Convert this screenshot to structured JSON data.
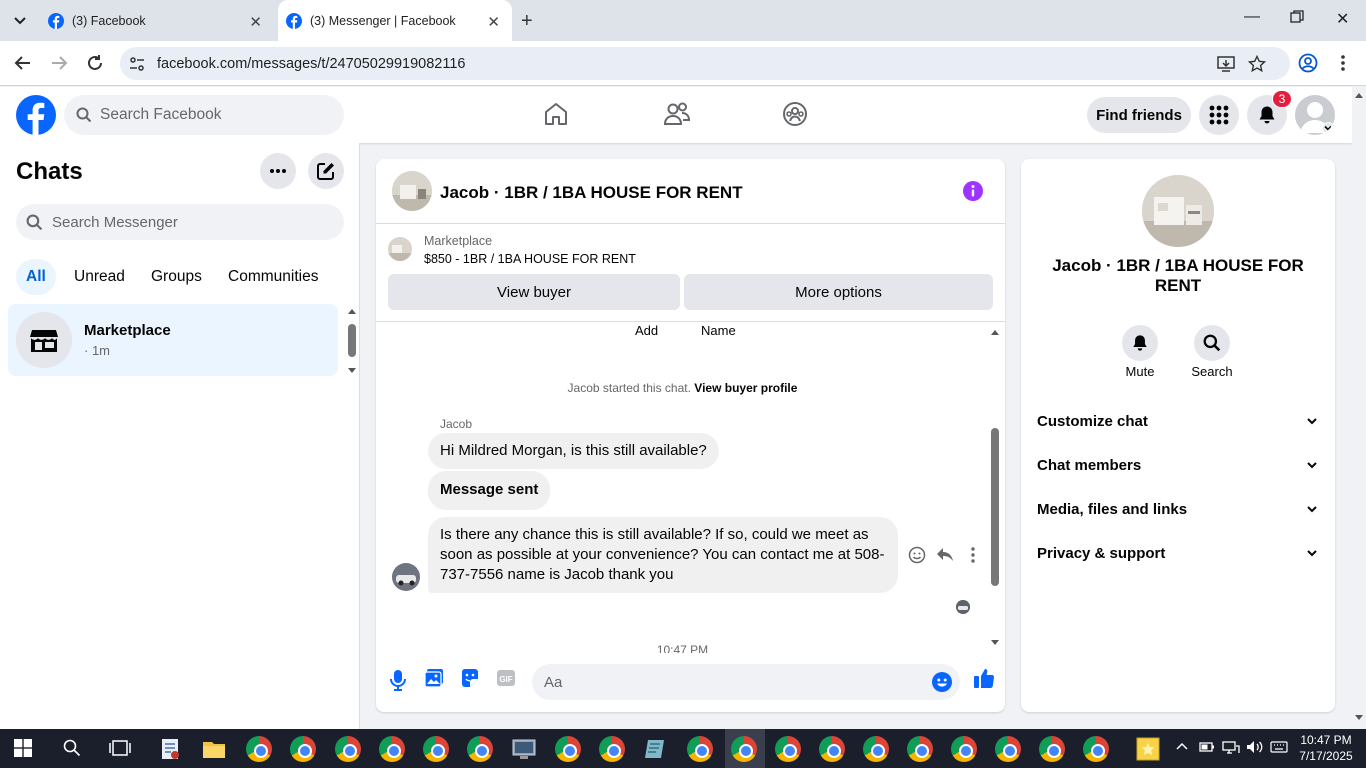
{
  "browser": {
    "tabs": [
      {
        "title": "(3) Facebook"
      },
      {
        "title": "(3) Messenger | Facebook"
      }
    ],
    "url": "facebook.com/messages/t/24705029919082116"
  },
  "fb_header": {
    "search_placeholder": "Search Facebook",
    "find_friends": "Find friends",
    "notification_count": "3"
  },
  "sidebar": {
    "title": "Chats",
    "search_placeholder": "Search Messenger",
    "filters": [
      "All",
      "Unread",
      "Groups",
      "Communities"
    ],
    "chats": [
      {
        "name": "Marketplace",
        "meta": "· 1m"
      }
    ]
  },
  "conversation": {
    "title": "Jacob · 1BR / 1BA HOUSE FOR RENT",
    "marketplace_label": "Marketplace",
    "listing": "$850 - 1BR / 1BA HOUSE FOR RENT",
    "view_buyer": "View buyer",
    "more_options": "More options",
    "partial_top_left": "Add",
    "partial_top_right": "Name",
    "start_text": "Jacob started this chat.",
    "start_link": "View buyer profile",
    "sender_name": "Jacob",
    "messages": [
      {
        "text": "Hi Mildred Morgan, is this still available?"
      },
      {
        "text": "Message sent"
      },
      {
        "text": "Is there any chance this is still available? If so, could we meet as soon as possible at your convenience? You can contact me at 508-737-7556 name is Jacob thank you"
      }
    ],
    "timestamp": "10:47 PM",
    "input_placeholder": "Aa"
  },
  "details": {
    "title": "Jacob · 1BR / 1BA HOUSE FOR RENT",
    "actions": [
      "Mute",
      "Search"
    ],
    "sections": [
      "Customize chat",
      "Chat members",
      "Media, files and links",
      "Privacy & support"
    ]
  },
  "taskbar": {
    "time": "10:47 PM",
    "date": "7/17/2025"
  },
  "colors": {
    "fb_blue": "#0866ff",
    "messenger_purple": "#a033ff",
    "selected_chat": "#ebf5ff",
    "notification_red": "#e41e3f"
  }
}
